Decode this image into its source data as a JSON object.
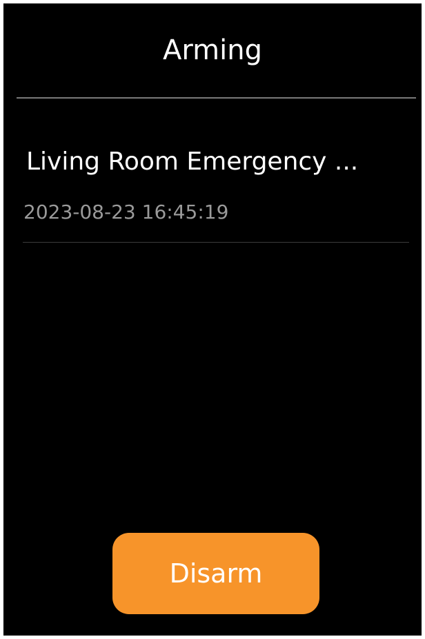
{
  "header": {
    "title": "Arming"
  },
  "alarms": [
    {
      "name": "Living Room Emergency ...",
      "timestamp": "2023-08-23 16:45:19"
    }
  ],
  "actions": {
    "disarm_label": "Disarm"
  },
  "colors": {
    "background": "#000000",
    "accent": "#f7942a",
    "primary_text": "#ffffff",
    "secondary_text": "#9a9a9a",
    "divider": "#7a7a7a"
  }
}
